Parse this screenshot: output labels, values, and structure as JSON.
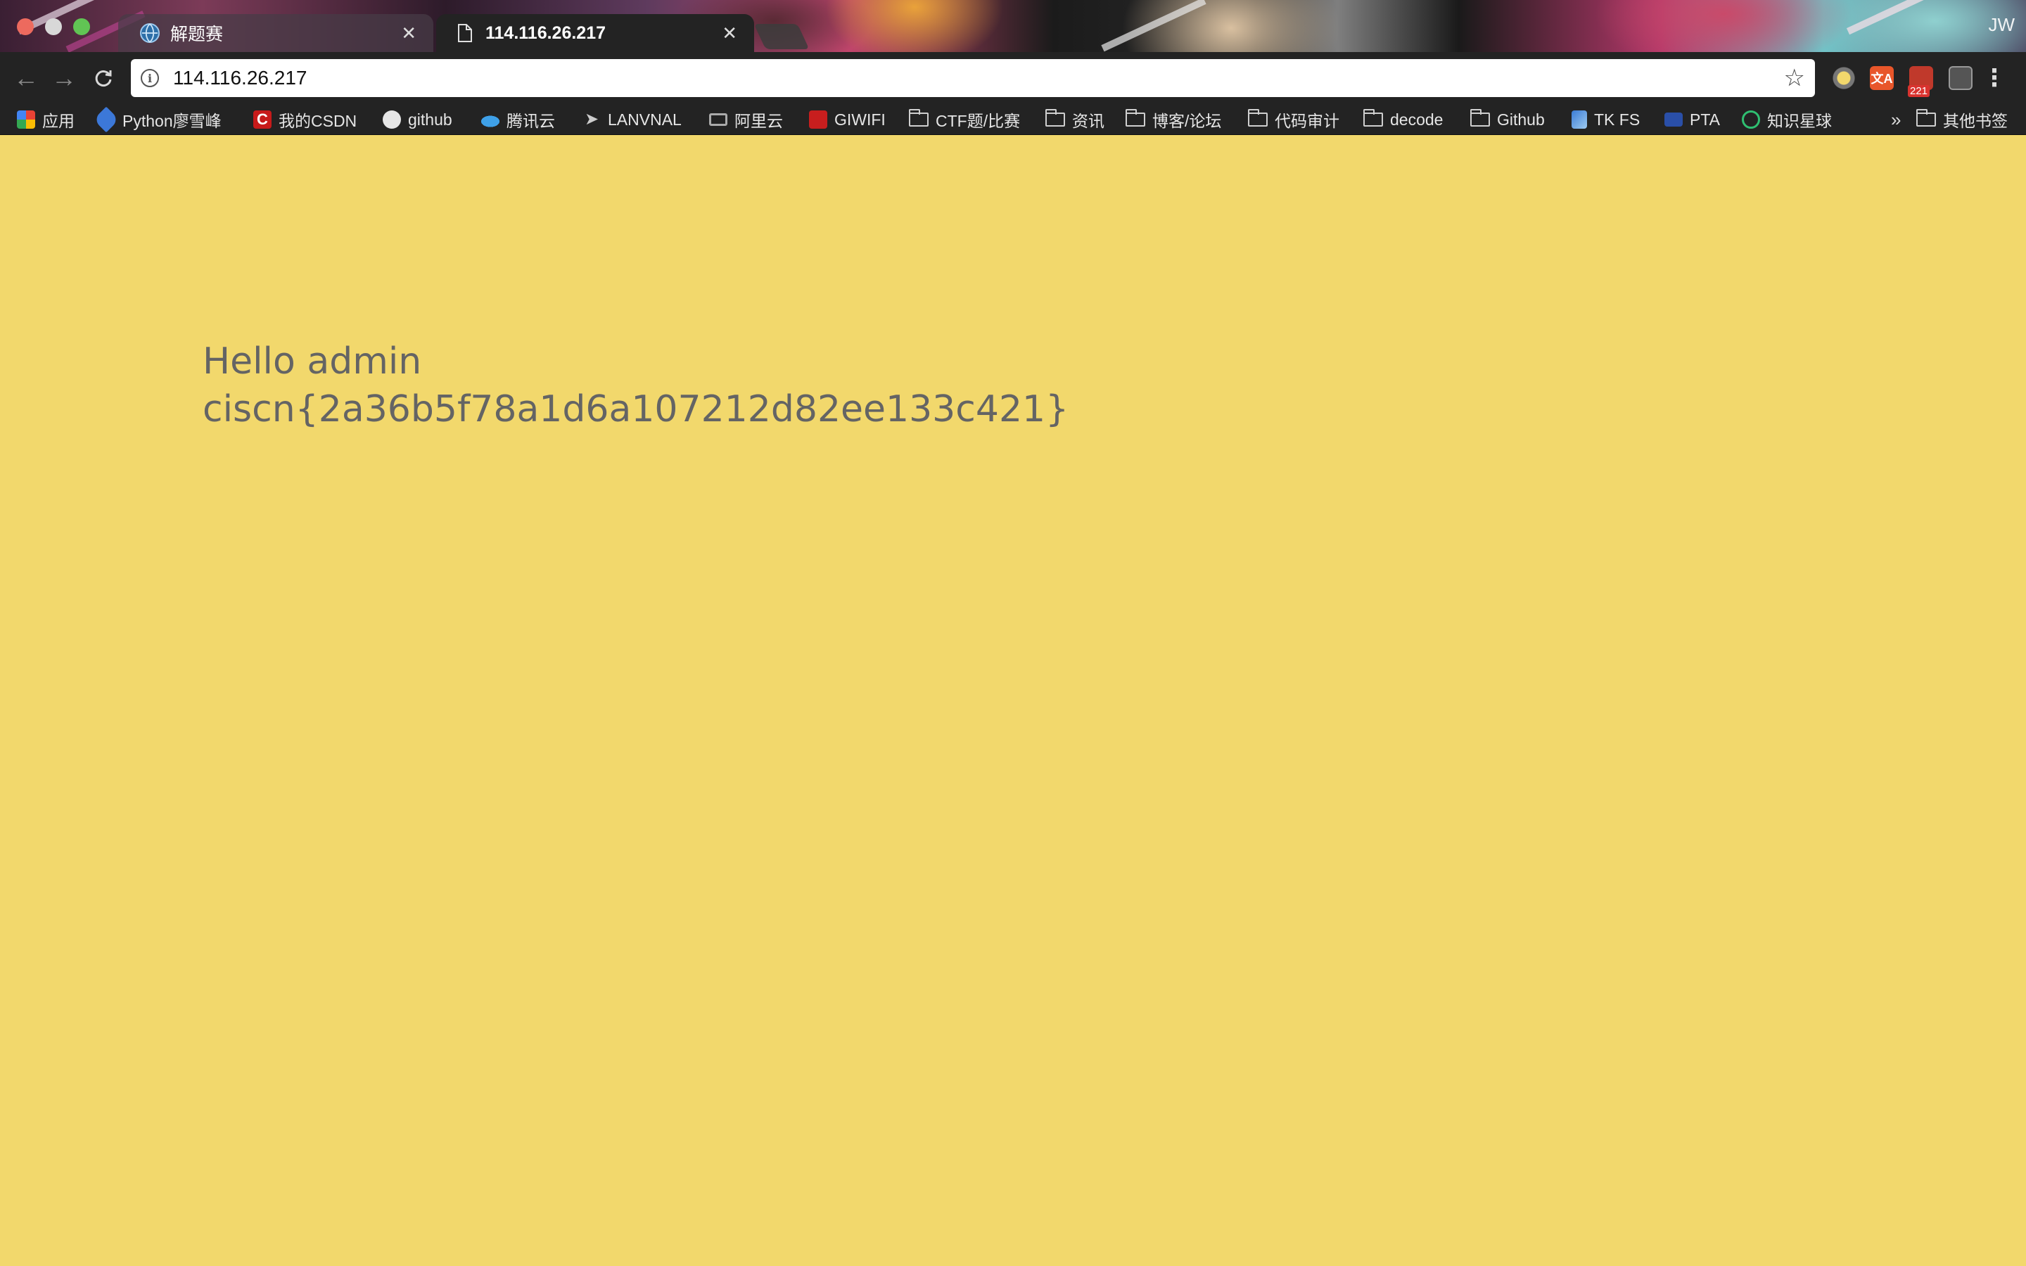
{
  "window": {
    "profile_label": "JW"
  },
  "tabs": [
    {
      "title": "解题赛",
      "icon": "globe-icon",
      "active": false
    },
    {
      "title": "114.116.26.217",
      "icon": "document-icon",
      "active": true
    }
  ],
  "toolbar": {
    "url": "114.116.26.217",
    "extension_badge": "221"
  },
  "bookmarks": [
    {
      "label": "应用",
      "icon": "apps-grid-icon"
    },
    {
      "label": "Python廖雪峰",
      "icon": "rocket-icon"
    },
    {
      "label": "我的CSDN",
      "icon": "csdn-icon"
    },
    {
      "label": "github",
      "icon": "github-icon"
    },
    {
      "label": "腾讯云",
      "icon": "cloud-icon"
    },
    {
      "label": "LANVNAL",
      "icon": "paper-plane-icon"
    },
    {
      "label": "阿里云",
      "icon": "aliyun-icon"
    },
    {
      "label": "GIWIFI",
      "icon": "giwifi-icon"
    },
    {
      "label": "CTF题/比赛",
      "icon": "folder-icon"
    },
    {
      "label": "资讯",
      "icon": "folder-icon"
    },
    {
      "label": "博客/论坛",
      "icon": "folder-icon"
    },
    {
      "label": "代码审计",
      "icon": "folder-icon"
    },
    {
      "label": "decode",
      "icon": "folder-icon"
    },
    {
      "label": "Github",
      "icon": "folder-icon"
    },
    {
      "label": "TK FS",
      "icon": "tk-icon"
    },
    {
      "label": "PTA",
      "icon": "pta-icon"
    },
    {
      "label": "知识星球",
      "icon": "planet-icon"
    }
  ],
  "bookmarks_overflow": "»",
  "other_bookmarks": "其他书签",
  "page": {
    "greeting": "Hello admin",
    "flag": "ciscn{2a36b5f78a1d6a107212d82ee133c421}"
  },
  "colors": {
    "page_background": "#f2d86c",
    "page_text": "#646464",
    "toolbar_background": "#232323"
  }
}
